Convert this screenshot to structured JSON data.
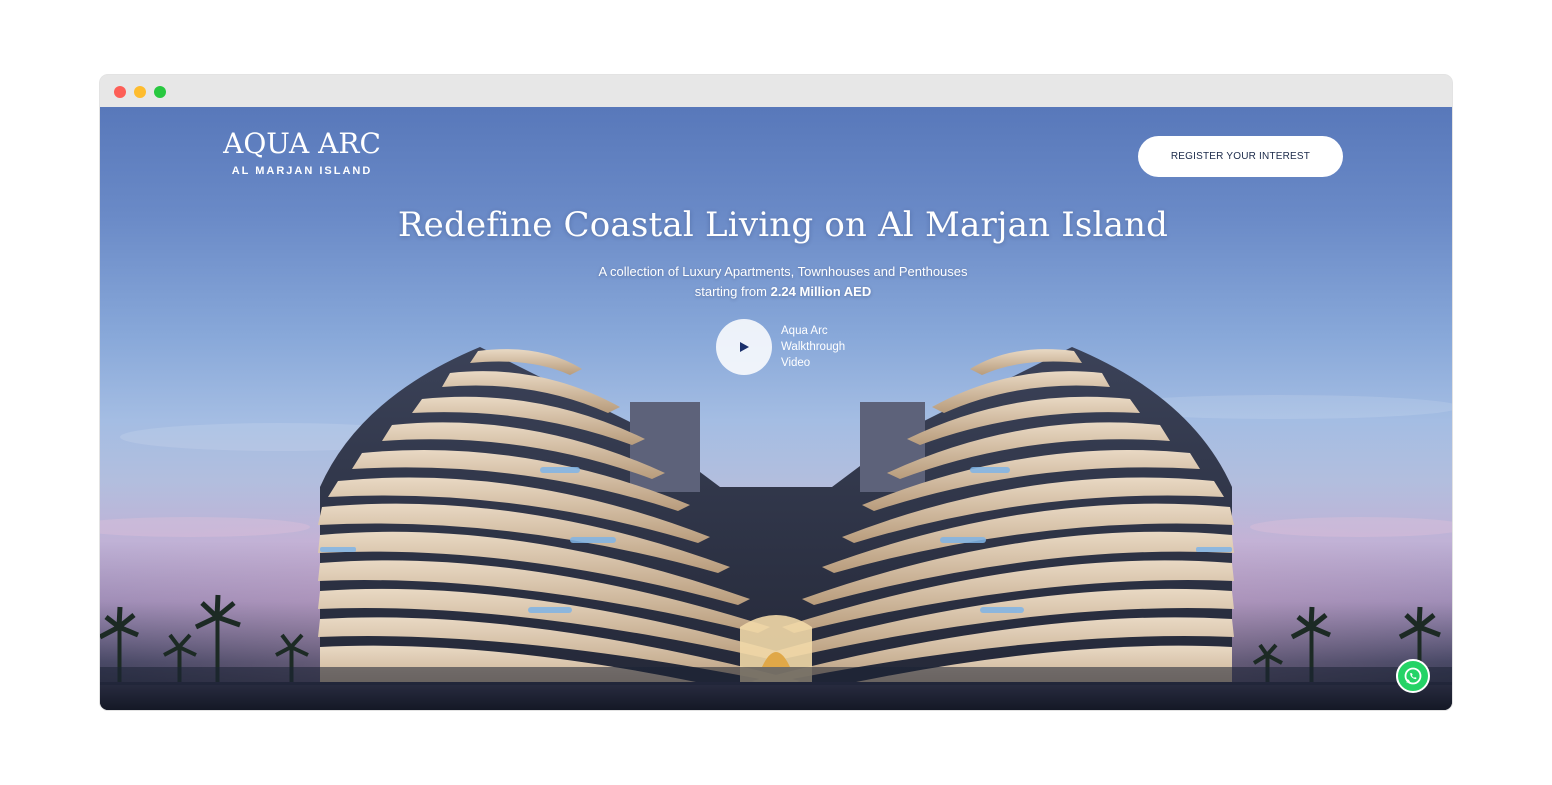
{
  "window": {
    "controls": [
      "close",
      "minimize",
      "zoom"
    ]
  },
  "header": {
    "logo_main": "AQUA ARC",
    "logo_sub": "AL MARJAN ISLAND",
    "register_label": "REGISTER YOUR INTEREST"
  },
  "hero": {
    "headline": "Redefine Coastal Living on Al Marjan Island",
    "subline_1": "A collection of Luxury Apartments, Townhouses and Penthouses",
    "subline_2_prefix": "starting from ",
    "subline_2_price": "2.24 Million AED",
    "video_label_line1": "Aqua Arc",
    "video_label_line2": "Walkthrough",
    "video_label_line3": "Video",
    "play_icon": "play-icon"
  },
  "floating": {
    "whatsapp_icon": "whatsapp-icon"
  },
  "colors": {
    "sky_top": "#5878ba",
    "button_text": "#1b2a4a",
    "whatsapp": "#25d366"
  }
}
